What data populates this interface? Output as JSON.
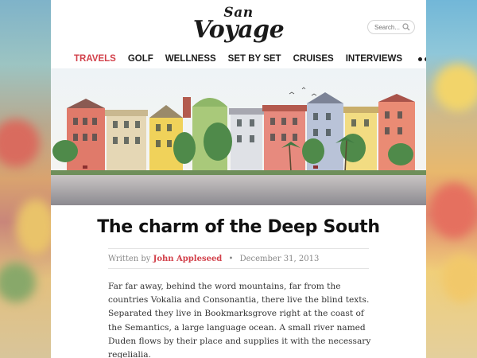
{
  "site": {
    "logo_line1": "San",
    "logo_line2": "Voyage"
  },
  "search": {
    "placeholder": "Search..."
  },
  "nav": {
    "items": [
      {
        "label": "TRAVELS",
        "active": true
      },
      {
        "label": "GOLF"
      },
      {
        "label": "WELLNESS"
      },
      {
        "label": "SET BY SET"
      },
      {
        "label": "CRUISES"
      },
      {
        "label": "INTERVIEWS"
      }
    ],
    "more_icon": "ellipsis-icon"
  },
  "article": {
    "title": "The charm of the Deep South",
    "written_by": "Written by",
    "author": "John Appleseed",
    "separator": "•",
    "date": "December 31, 2013",
    "body": "Far far away, behind the word mountains, far from the countries Vokalia and Consonantia, there live the blind texts. Separated they live in Bookmarksgrove right at the coast of the Semantics, a large language ocean. A small river named Duden flows by their place and supplies it with the necessary regelialia."
  },
  "colors": {
    "accent": "#d2404a",
    "text": "#1c1c1c",
    "meta": "#888888"
  }
}
